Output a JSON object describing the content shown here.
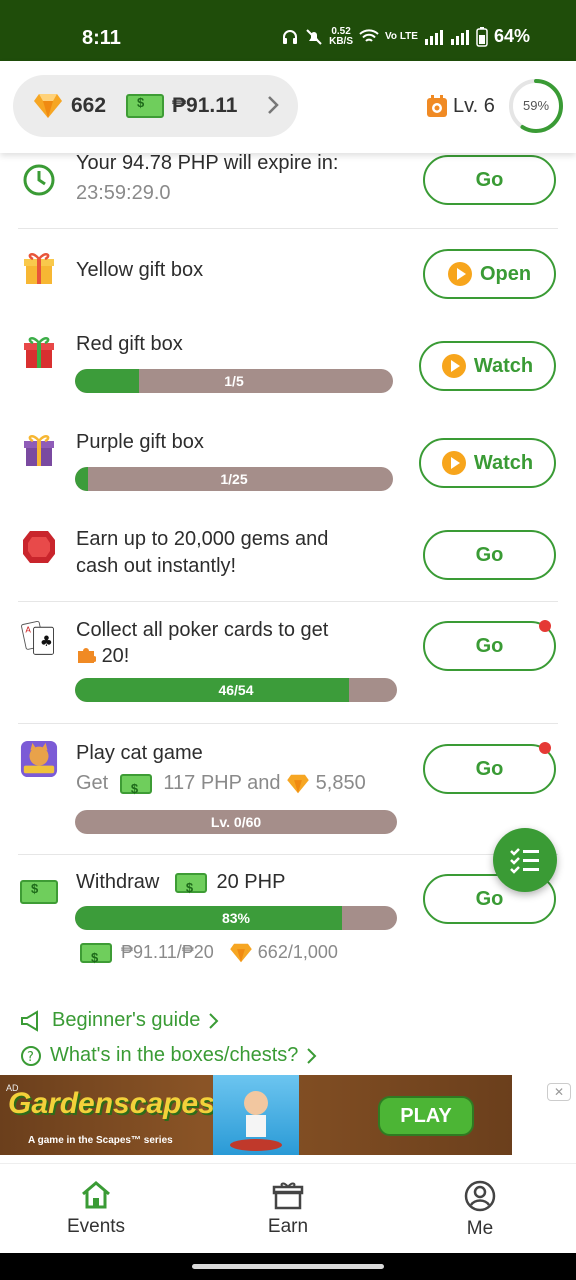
{
  "status_bar": {
    "time": "8:11",
    "speed": "0.52",
    "speed_unit": "KB/S",
    "network": "Vo LTE",
    "battery": "64%"
  },
  "header": {
    "gems": "662",
    "cash": "₱91.11",
    "level": "Lv. 6",
    "progress_percent": "59%",
    "progress_value": 0.59
  },
  "tasks": {
    "expire": {
      "title": "Your 94.78 PHP will expire in:",
      "countdown": "23:59:29.0",
      "button": "Go"
    },
    "yellow": {
      "title": "Yellow gift box",
      "button": "Open"
    },
    "red": {
      "title": "Red gift box",
      "progress_label": "1/5",
      "progress": 0.2,
      "button": "Watch"
    },
    "purple": {
      "title": "Purple gift box",
      "progress_label": "1/25",
      "progress": 0.04,
      "button": "Watch"
    },
    "gems": {
      "title_line1": "Earn up to 20,000 gems and",
      "title_line2": "cash out instantly!",
      "button": "Go"
    },
    "poker": {
      "title_line1": "Collect all poker cards to get",
      "title_line2": "20!",
      "progress_label": "46/54",
      "progress": 0.85,
      "button": "Go"
    },
    "cat": {
      "title": "Play cat game",
      "get_label": "Get",
      "cash_amount": "117 PHP and",
      "gem_amount": "5,850",
      "progress_label": "Lv. 0/60",
      "progress": 0.0,
      "button": "Go"
    },
    "withdraw": {
      "title": "Withdraw",
      "amount": "20 PHP",
      "progress_label": "83%",
      "progress": 0.83,
      "cash_ratio": "₱91.11/₱20",
      "gem_ratio": "662/1,000",
      "button": "Go"
    }
  },
  "links": {
    "guide": "Beginner's guide",
    "boxes": "What's in the boxes/chests?"
  },
  "ad": {
    "tag": "AD",
    "brand": "Gardenscapes",
    "subtitle": "A game in the Scapes™ series",
    "cta": "PLAY",
    "close": "✕"
  },
  "nav": {
    "events": "Events",
    "earn": "Earn",
    "me": "Me"
  },
  "colors": {
    "status_bar": "#1f4d0a",
    "accent": "#3a9b35",
    "bar_track": "#a58e8a",
    "play_icon": "#f7a51c"
  }
}
